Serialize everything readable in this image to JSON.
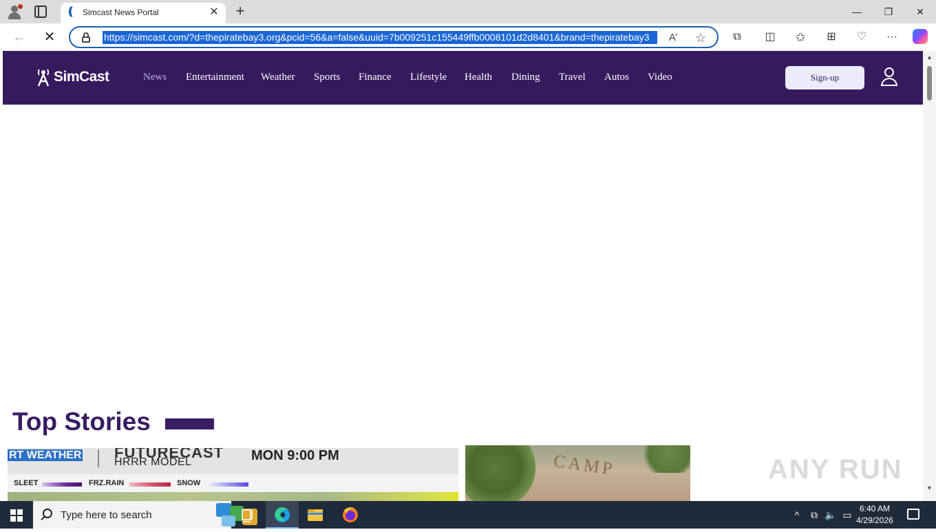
{
  "browser": {
    "tab_title": "Simcast News Portal",
    "url": "https://simcast.com/?d=thepiratebay3.org&pcid=56&a=false&uuid=7b009251c155449ffb0008101d2d8401&brand=thepiratebay3",
    "new_tab_glyph": "+",
    "close_tab_glyph": "✕",
    "window_controls": {
      "minimize": "—",
      "maximize": "❐",
      "close": "✕"
    },
    "back_glyph": "←",
    "stop_glyph": "✕",
    "read_aloud_glyph": "A’",
    "favorite_glyph": "☆",
    "toolbar_icons": {
      "extensions": "⧉",
      "split": "◫",
      "favorites": "✩",
      "collections": "⊞",
      "performance": "♡",
      "more": "···"
    }
  },
  "site": {
    "logo_text": "SimCast",
    "nav": [
      {
        "label": "News",
        "active": true
      },
      {
        "label": "Entertainment",
        "active": false
      },
      {
        "label": "Weather",
        "active": false
      },
      {
        "label": "Sports",
        "active": false
      },
      {
        "label": "Finance",
        "active": false
      },
      {
        "label": "Lifestyle",
        "active": false
      },
      {
        "label": "Health",
        "active": false
      },
      {
        "label": "Dining",
        "active": false
      },
      {
        "label": "Travel",
        "active": false
      },
      {
        "label": "Autos",
        "active": false
      },
      {
        "label": "Video",
        "active": false
      }
    ],
    "signup_label": "Sign-up",
    "header_color": "#371a5e",
    "accent_color": "#3a1c62"
  },
  "main": {
    "section_title": "Top Stories",
    "story1": {
      "weather_label": "RT WEATHER",
      "futurecast": "FUTURECAST",
      "model": "HRRR MODEL",
      "time": "MON 9:00 PM",
      "legend": [
        "SLEET",
        "FRZ.RAIN",
        "SNOW"
      ]
    },
    "story2": {
      "sign_text": "CAMP"
    }
  },
  "watermark": "ANY RUN",
  "scrollbar": {
    "up": "▲",
    "down": "▼"
  },
  "taskbar": {
    "search_placeholder": "Type here to search",
    "time": "6:40 AM",
    "date": "4/29/2026",
    "tray_chevron": "^"
  }
}
